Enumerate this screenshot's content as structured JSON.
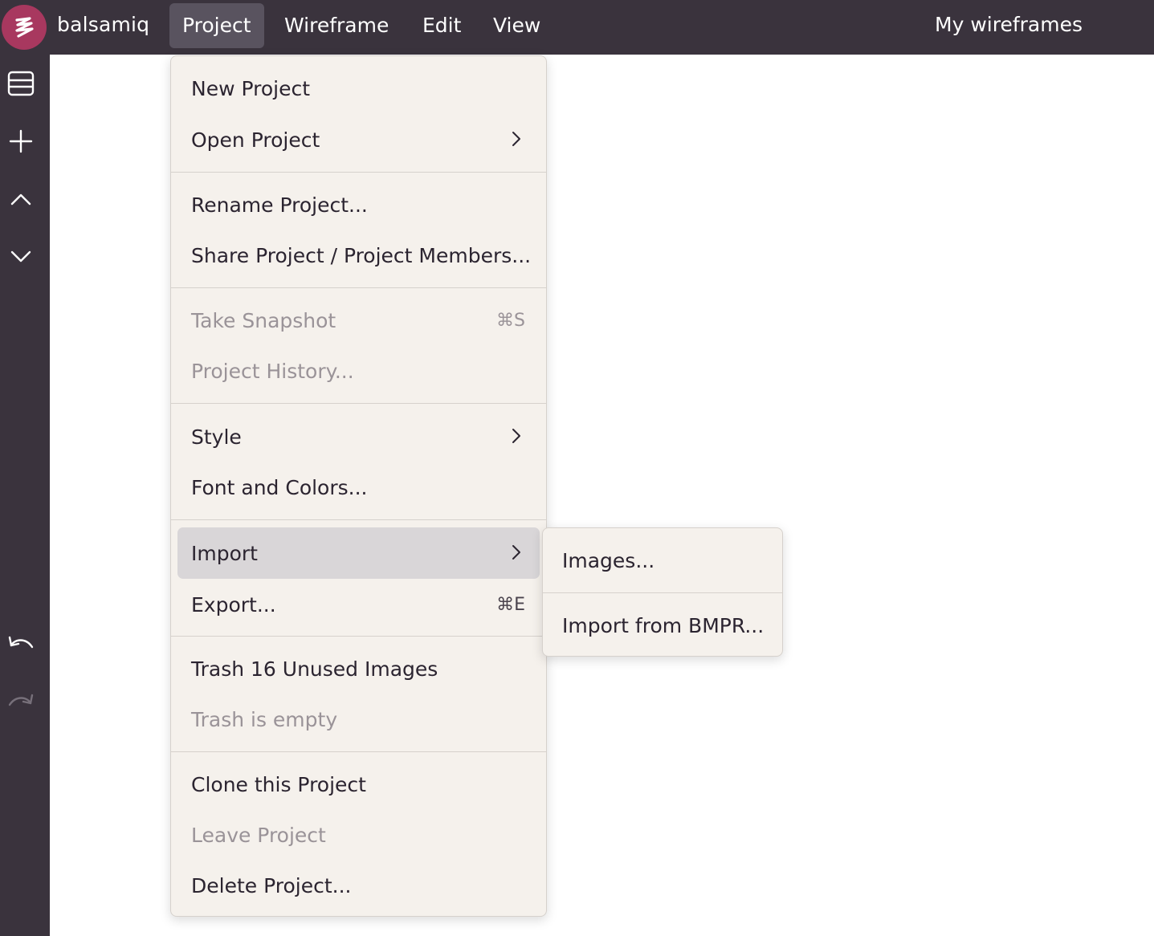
{
  "app": {
    "brand": "balsamiq",
    "my_wireframes": "My wireframes"
  },
  "menubar": [
    {
      "label": "Project",
      "active": true
    },
    {
      "label": "Wireframe"
    },
    {
      "label": "Edit"
    },
    {
      "label": "View"
    }
  ],
  "sidebar": {
    "icons": [
      "panels-icon",
      "plus-icon",
      "chevron-up-icon",
      "chevron-down-icon",
      "undo-icon",
      "redo-icon"
    ]
  },
  "project_menu": {
    "new_project": "New Project",
    "open_project": "Open Project",
    "rename_project": "Rename Project...",
    "share_project": "Share Project / Project Members...",
    "take_snapshot": "Take Snapshot",
    "take_snapshot_shortcut": "⌘S",
    "project_history": "Project History...",
    "style": "Style",
    "font_colors": "Font and Colors...",
    "import": "Import",
    "export": "Export...",
    "export_shortcut": "⌘E",
    "trash_unused": "Trash 16 Unused Images",
    "trash_empty": "Trash is empty",
    "clone_project": "Clone this Project",
    "leave_project": "Leave Project",
    "delete_project": "Delete Project..."
  },
  "import_submenu": {
    "images": "Images...",
    "import_bmpr": "Import from BMPR..."
  },
  "colors": {
    "topbar": "#3a333d",
    "logo": "#a8385f",
    "menu_bg": "#f5f1ec",
    "hover": "#d9d6d8"
  }
}
